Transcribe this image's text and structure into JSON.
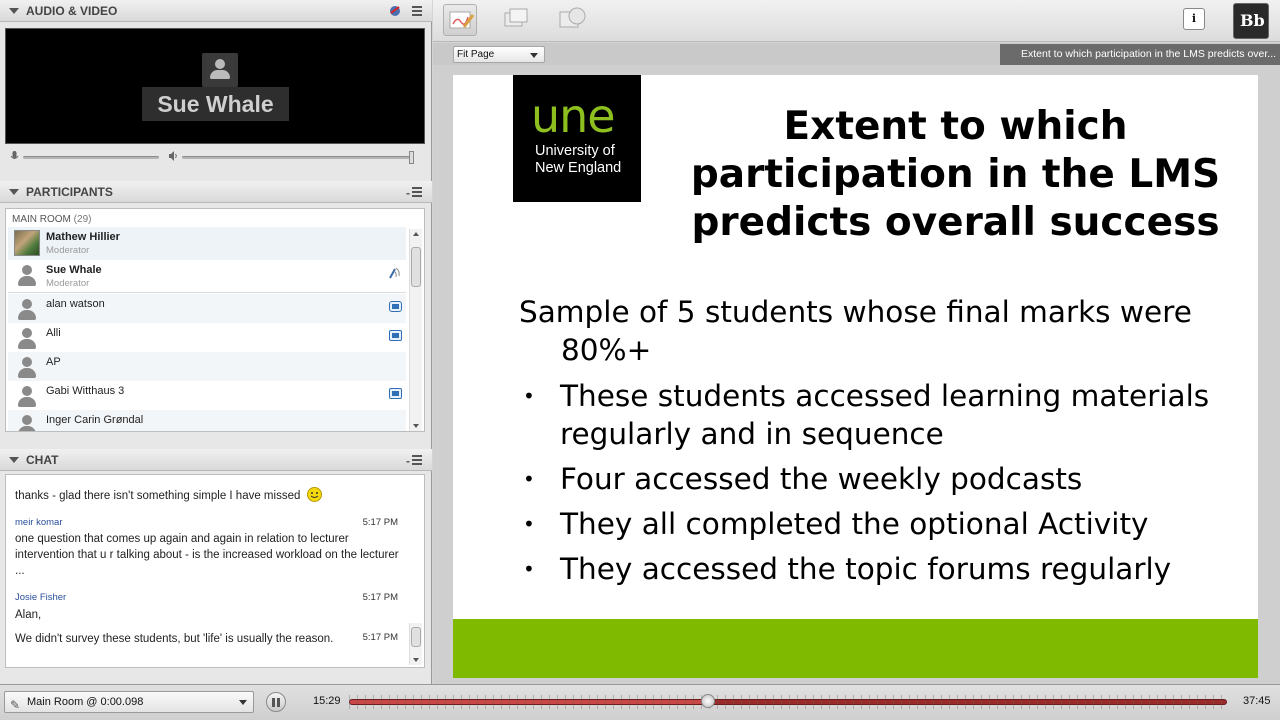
{
  "audio_video": {
    "title": "AUDIO & VIDEO",
    "speaker_name": "Sue Whale"
  },
  "participants": {
    "title": "PARTICIPANTS",
    "room_label": "MAIN ROOM",
    "room_count": "(29)",
    "list": [
      {
        "name": "Mathew Hillier",
        "role": "Moderator"
      },
      {
        "name": "Sue Whale",
        "role": "Moderator"
      },
      {
        "name": "alan watson"
      },
      {
        "name": "Alli"
      },
      {
        "name": "AP"
      },
      {
        "name": "Gabi Witthaus 3"
      },
      {
        "name": "Inger Carin Grøndal"
      }
    ]
  },
  "chat": {
    "title": "CHAT",
    "messages": [
      {
        "text": "thanks - glad there isn't something simple I have missed"
      },
      {
        "author": "meir komar",
        "time": "5:17 PM",
        "text": "one question that comes up again and again in relation to lecturer intervention that u r talking about - is the increased workload on the lecturer ..."
      },
      {
        "author": "Josie Fisher",
        "time": "5:17 PM",
        "text": "Alan,"
      },
      {
        "time": "5:17 PM",
        "text": "We didn't survey these students, but 'life' is usually the reason."
      }
    ]
  },
  "viewer": {
    "fit_label": "Fit Page",
    "slide_title_strip": "Extent to which participation in the LMS predicts over..."
  },
  "slide": {
    "logo_text": "une",
    "logo_sub_1": "University of",
    "logo_sub_2": "New England",
    "title": "Extent to which participation in the LMS predicts overall success",
    "lead": "Sample of 5 students whose final marks were 80%+",
    "bullets": [
      "These students accessed learning materials regularly and in sequence",
      "Four accessed the weekly podcasts",
      "They all completed the optional Activity",
      "They accessed the topic forums regularly"
    ],
    "band_color": "#7fba00"
  },
  "playback": {
    "room_label": "Main Room @ 0:00.098",
    "time_current": "15:29",
    "time_total": "37:45",
    "progress": 0.41
  },
  "icons": {
    "toolbar": [
      "whiteboard-icon",
      "app-share-icon",
      "web-tour-icon",
      "info-icon",
      "blackboard-logo-icon"
    ]
  }
}
